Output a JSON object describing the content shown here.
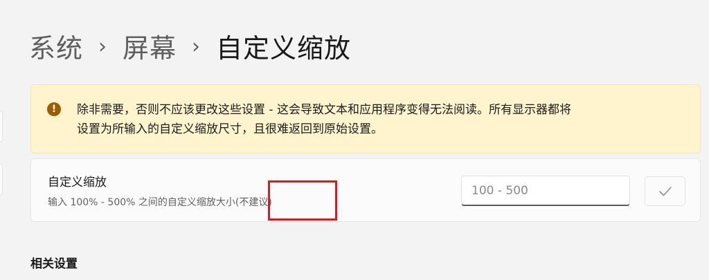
{
  "breadcrumb": {
    "items": [
      "系统",
      "屏幕"
    ],
    "separator": "›",
    "current": "自定义缩放"
  },
  "warning": {
    "icon": "warning-exclamation-icon",
    "line1": "除非需要，否则不应该更改这些设置 - 这会导致文本和应用程序变得无法阅读。所有显示器都将",
    "line2": "设置为所输入的自定义缩放尺寸，且很难返回到原始设置。",
    "background_color": "#fff4ce",
    "icon_color": "#9d5d00"
  },
  "custom_scaling": {
    "title": "自定义缩放",
    "description": "输入 100% - 500% 之间的自定义缩放大小(不建议)",
    "input_value": "",
    "input_placeholder": "100 - 500",
    "confirm_icon": "checkmark-icon"
  },
  "related_settings": {
    "heading": "相关设置"
  },
  "annotation": {
    "highlight_color": "#e0181d"
  }
}
